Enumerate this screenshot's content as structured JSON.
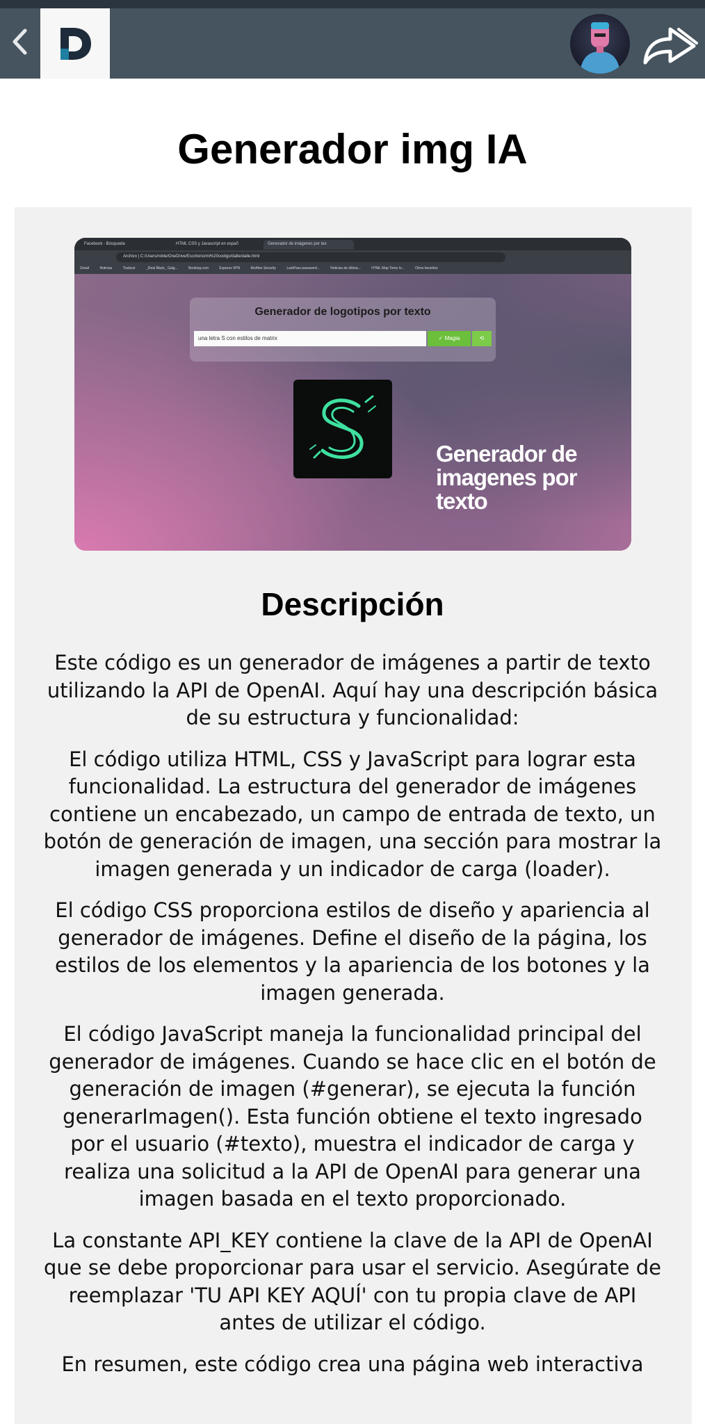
{
  "header": {
    "logo_letter": "D",
    "back_icon": "chevron-left-icon",
    "share_icon": "share-arrow-icon",
    "colors": {
      "bar": "#46545f",
      "status_bar": "#2a3540",
      "logo_bg": "#f7f7f7",
      "logo_accent": "#1f7fa0"
    }
  },
  "page": {
    "title": "Generador img IA"
  },
  "screenshot": {
    "tabs": [
      "Facebook - Búsqueda",
      "HTML CSS y Javascript en españ",
      "Generador de imágenes por tex"
    ],
    "url": "Archivo  |  C:/Users/roble/OneDrive/Escritorio/mi%20codigo/dalle/dalle.html",
    "bookmarks": [
      "Gmail",
      "Noticias",
      "Traducir",
      "_Real Black_ Galg...",
      "Booking.com",
      "Express VPN",
      "McAfee Security",
      "LastPass password...",
      "Noticias de última...",
      "HTML Map Tomo lo...",
      "Otros favoritos"
    ],
    "panel_title": "Generador de logotipos por texto",
    "input_value": "una letra S con estilos de matrix",
    "button_label": "✓ Magia",
    "button2_label": "⟲",
    "promo_text": "Generador de imagenes por texto"
  },
  "description": {
    "heading": "Descripción",
    "paragraphs": [
      "Este código es un generador de imágenes a partir de texto utilizando la API de OpenAI. Aquí hay una descripción básica de su estructura y funcionalidad:",
      "El código utiliza HTML, CSS y JavaScript para lograr esta funcionalidad. La estructura del generador de imágenes contiene un encabezado, un campo de entrada de texto, un botón de generación de imagen, una sección para mostrar la imagen generada y un indicador de carga (loader).",
      "El código CSS proporciona estilos de diseño y apariencia al generador de imágenes. Define el diseño de la página, los estilos de los elementos y la apariencia de los botones y la imagen generada.",
      "El código JavaScript maneja la funcionalidad principal del generador de imágenes. Cuando se hace clic en el botón de generación de imagen (#generar), se ejecuta la función generarImagen(). Esta función obtiene el texto ingresado por el usuario (#texto), muestra el indicador de carga y realiza una solicitud a la API de OpenAI para generar una imagen basada en el texto proporcionado.",
      "La constante API_KEY contiene la clave de la API de OpenAI que se debe proporcionar para usar el servicio. Asegúrate de reemplazar 'TU API KEY AQUÍ' con tu propia clave de API antes de utilizar el código.",
      "En resumen, este código crea una página web interactiva"
    ]
  }
}
